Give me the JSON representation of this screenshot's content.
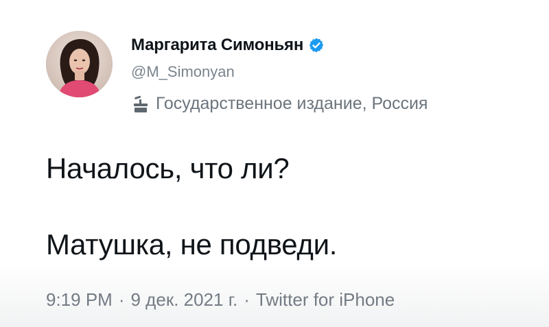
{
  "author": {
    "display_name": "Маргарита Симоньян",
    "handle": "@M_Simonyan",
    "verified": true,
    "verified_color": "#1d9bf0"
  },
  "label": {
    "icon": "government-podium-icon",
    "text": "Государственное издание, Россия"
  },
  "tweet": {
    "lines": [
      "Началось, что ли?",
      "Матушка, не подведи."
    ]
  },
  "meta": {
    "time": "9:19 PM",
    "separator": "·",
    "date": "9 дек. 2021 г.",
    "source": "Twitter for iPhone"
  },
  "colors": {
    "text_primary": "#0f1419",
    "text_secondary": "#737b83",
    "background": "#ffffff"
  }
}
